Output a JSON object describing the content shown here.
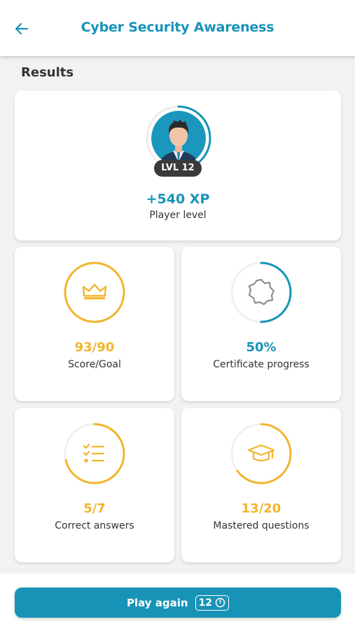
{
  "header": {
    "title": "Cyber Security Awareness",
    "back_icon": "arrow-left-icon"
  },
  "section": {
    "title": "Results"
  },
  "player": {
    "level_badge": "LVL 12",
    "xp": "+540 XP",
    "label": "Player level",
    "ring_progress": 0.45
  },
  "stats": [
    {
      "value": "93/90",
      "label": "Score/Goal",
      "icon": "crown-icon",
      "progress": 1.0,
      "color": "#f2b52e"
    },
    {
      "value": "50%",
      "label": "Certificate progress",
      "icon": "certificate-badge-icon",
      "progress": 0.5,
      "color": "#1893b8"
    },
    {
      "value": "5/7",
      "label": "Correct answers",
      "icon": "checklist-icon",
      "progress": 0.714,
      "color": "#f2b52e"
    },
    {
      "value": "13/20",
      "label": "Mastered questions",
      "icon": "graduation-cap-icon",
      "progress": 0.65,
      "color": "#f2b52e"
    }
  ],
  "play_button": {
    "label": "Play again",
    "count": "12",
    "icon": "timer-icon"
  },
  "colors": {
    "accent": "#1893b8",
    "gold": "#f2b52e",
    "dark": "#3a3a3a"
  }
}
